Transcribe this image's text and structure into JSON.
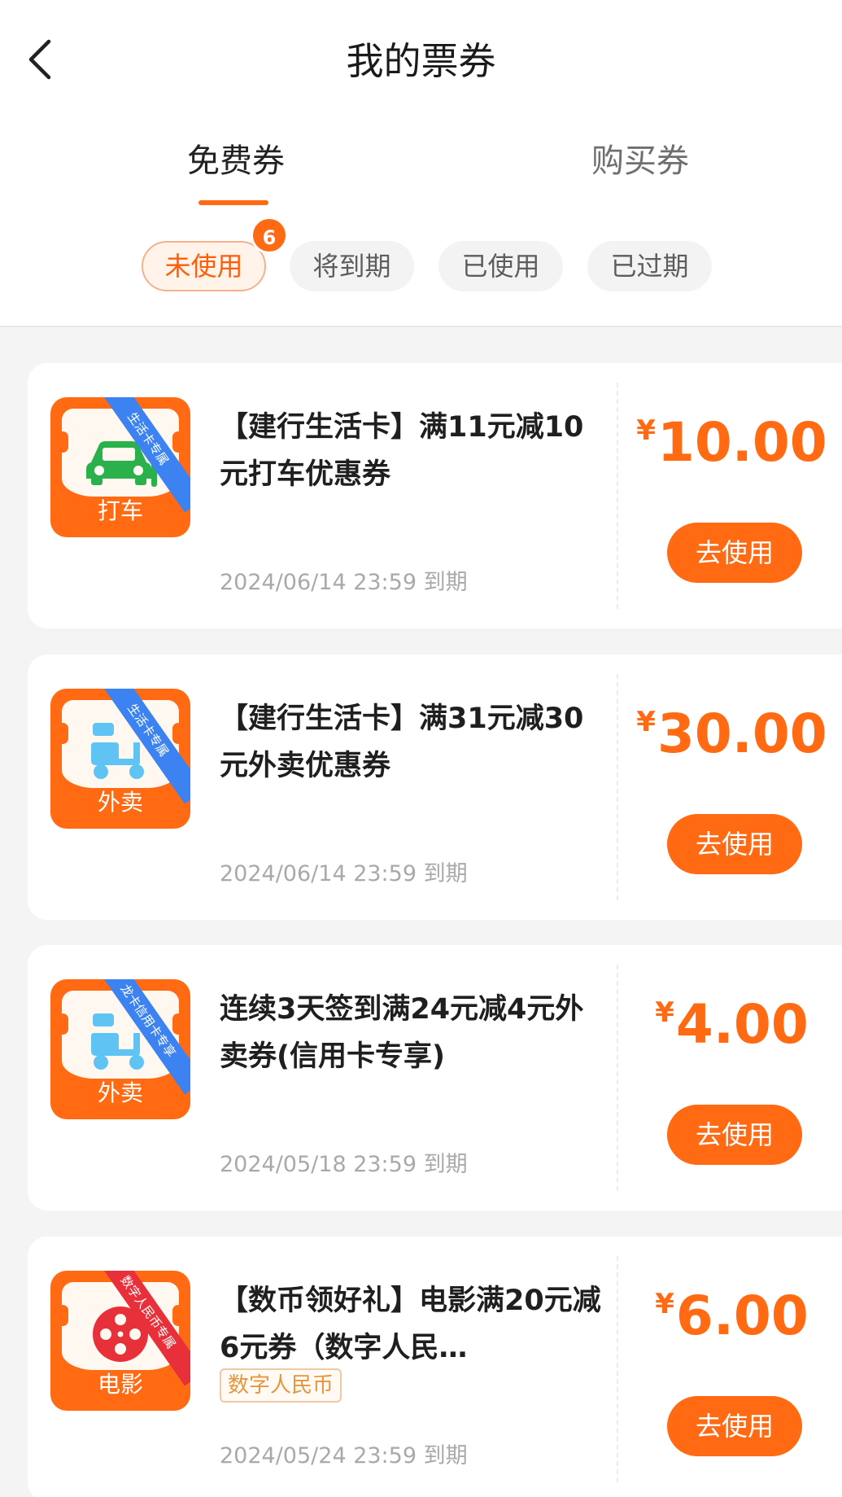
{
  "header": {
    "title": "我的票券",
    "back_icon": "chevron-left-icon"
  },
  "tabs": [
    {
      "label": "免费券",
      "active": true
    },
    {
      "label": "购买券",
      "active": false
    }
  ],
  "filters": [
    {
      "label": "未使用",
      "active": true,
      "badge": "6"
    },
    {
      "label": "将到期",
      "active": false
    },
    {
      "label": "已使用",
      "active": false
    },
    {
      "label": "已过期",
      "active": false
    }
  ],
  "colors": {
    "accent": "#ff6a13",
    "ribbon_blue": "#3c82f0",
    "ribbon_red": "#e8303a",
    "taxi_green": "#2bb14c",
    "scooter_blue": "#5fc4f4"
  },
  "coupons": [
    {
      "icon": "taxi-icon",
      "icon_label": "打车",
      "ribbon": "生活卡专属",
      "title": "【建行生活卡】满11元减10元打车优惠券",
      "expiry": "2024/06/14 23:59 到期",
      "currency": "¥",
      "amount": "10.00",
      "button": "去使用"
    },
    {
      "icon": "scooter-icon",
      "icon_label": "外卖",
      "ribbon": "生活卡专属",
      "title": "【建行生活卡】满31元减30元外卖优惠券",
      "expiry": "2024/06/14 23:59 到期",
      "currency": "¥",
      "amount": "30.00",
      "button": "去使用"
    },
    {
      "icon": "scooter-icon",
      "icon_label": "外卖",
      "ribbon": "龙卡信用卡专享",
      "title": "连续3天签到满24元减4元外卖券(信用卡专享)",
      "expiry": "2024/05/18 23:59 到期",
      "currency": "¥",
      "amount": "4.00",
      "button": "去使用"
    },
    {
      "icon": "film-reel-icon",
      "icon_label": "电影",
      "ribbon": "数字人民币专属",
      "title": "【数币领好礼】电影满20元减6元券（数字人民…",
      "tag": "数字人民币",
      "expiry": "2024/05/24 23:59 到期",
      "currency": "¥",
      "amount": "6.00",
      "button": "去使用"
    }
  ]
}
